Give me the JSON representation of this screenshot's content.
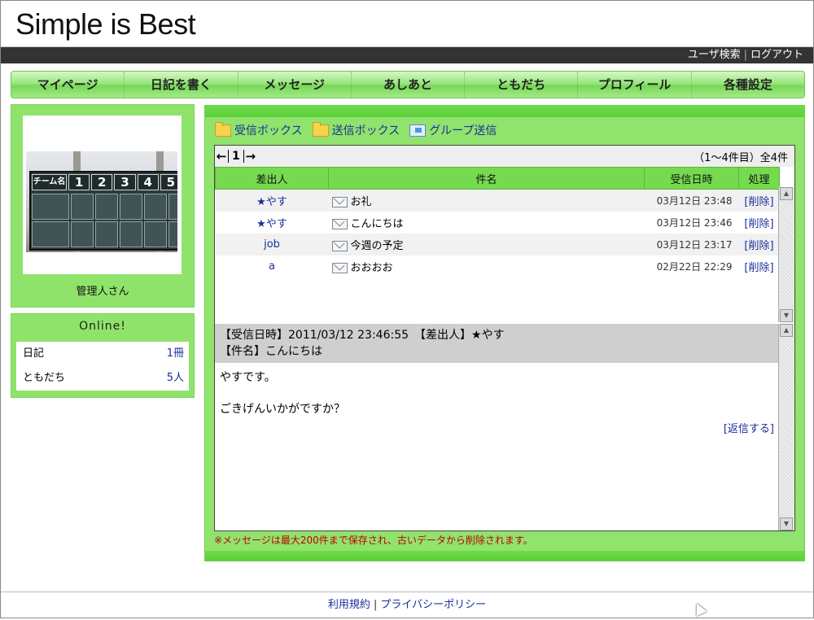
{
  "header": {
    "site_title": "Simple is Best"
  },
  "topbar": {
    "user_search": "ユーザ検索",
    "separator": "|",
    "logout": "ログアウト"
  },
  "nav": {
    "items": [
      "マイページ",
      "日記を書く",
      "メッセージ",
      "あしあと",
      "ともだち",
      "プロフィール",
      "各種設定"
    ]
  },
  "profile": {
    "name": "管理人さん",
    "photo_text": {
      "team_label": "チーム名",
      "columns": [
        "1",
        "2",
        "3",
        "4",
        "5"
      ]
    }
  },
  "online": {
    "title": "Online!",
    "rows": [
      {
        "label": "日記",
        "count": "1冊"
      },
      {
        "label": "ともだち",
        "count": "5人"
      }
    ]
  },
  "message_box": {
    "tabs": [
      {
        "label": "受信ボックス",
        "icon": "folder-icon"
      },
      {
        "label": "送信ボックス",
        "icon": "folder-icon"
      },
      {
        "label": "グループ送信",
        "icon": "group-send-icon"
      }
    ],
    "pager": {
      "prev": "←",
      "page": "1",
      "next": "→"
    },
    "count_info": "（1～4件目）全4件",
    "columns": [
      "差出人",
      "件名",
      "受信日時",
      "処理"
    ],
    "rows": [
      {
        "sender": "★やす",
        "subject": "お礼",
        "date": "03月12日 23:48",
        "action": "[削除]"
      },
      {
        "sender": "★やす",
        "subject": "こんにちは",
        "date": "03月12日 23:46",
        "action": "[削除]"
      },
      {
        "sender": "job",
        "subject": "今週の予定",
        "date": "03月12日 23:17",
        "action": "[削除]"
      },
      {
        "sender": "a",
        "subject": "おおおお",
        "date": "02月22日 22:29",
        "action": "[削除]"
      }
    ],
    "detail": {
      "received": "【受信日時】2011/03/12 23:46:55　【差出人】★やす",
      "subject": "【件名】こんにちは",
      "body_line1": "やすです。",
      "body_line2": "ごきげんいかがですか？",
      "reply": "[返信する]"
    },
    "notice": "※メッセージは最大200件まで保存され、古いデータから削除されます。"
  },
  "footer": {
    "terms": "利用規約",
    "separator": "|",
    "privacy": "プライバシーポリシー"
  },
  "colors": {
    "accent_green": "#76da4f",
    "link_blue": "#1a2f9a",
    "notice_red": "#c00000",
    "topbar": "#333333"
  }
}
